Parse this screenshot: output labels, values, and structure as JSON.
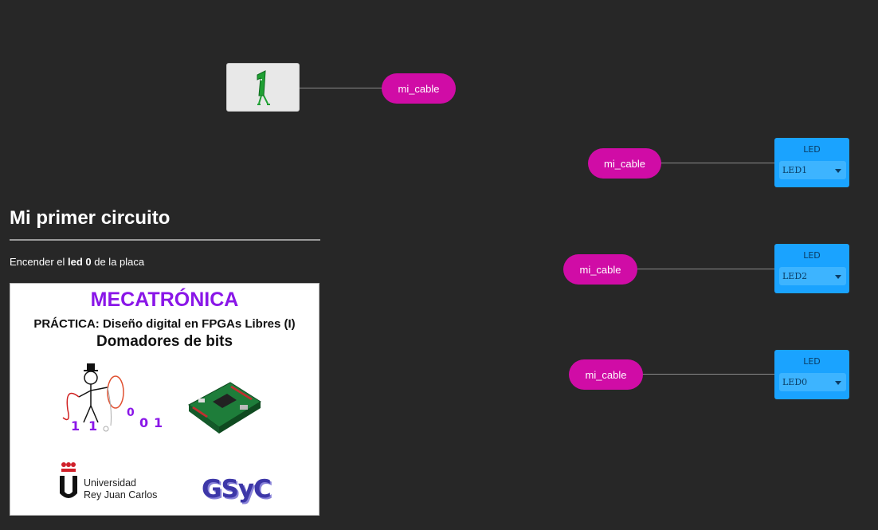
{
  "constant_block": {
    "value": "1"
  },
  "cables": [
    {
      "label": "mi_cable"
    },
    {
      "label": "mi_cable"
    },
    {
      "label": "mi_cable"
    },
    {
      "label": "mi_cable"
    }
  ],
  "led_blocks": [
    {
      "title": "LED",
      "selected": "LED1"
    },
    {
      "title": "LED",
      "selected": "LED2"
    },
    {
      "title": "LED",
      "selected": "LED0"
    }
  ],
  "info": {
    "title": "Mi primer circuito",
    "desc_prefix": "Encender el ",
    "desc_led": "led 0",
    "desc_suffix": " de la placa",
    "poster": {
      "title": "MECATRÓNICA",
      "subtitle": "PRÁCTICA: Diseño digital en FPGAs Libres (I)",
      "subtitle2": "Domadores de bits",
      "university_line1": "Universidad",
      "university_line2": "Rey Juan Carlos",
      "logo_text": "GSyC"
    }
  },
  "colors": {
    "background": "#272727",
    "cable": "#d00ca6",
    "led_block": "#1aa3ff",
    "constant_block": "#e8e8e8",
    "poster_title": "#8a16e8"
  }
}
